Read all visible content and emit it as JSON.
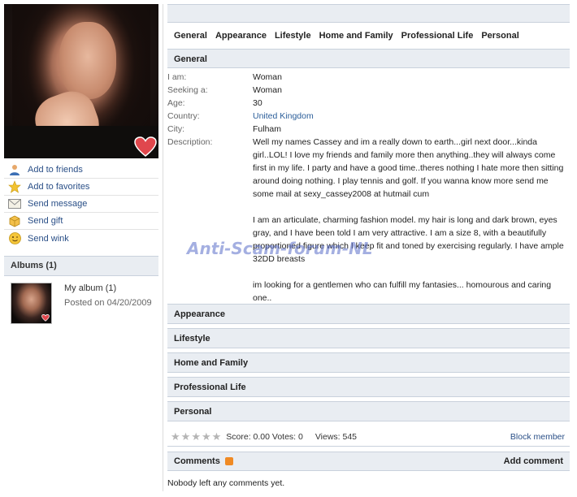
{
  "sidebar": {
    "actions": [
      {
        "label": "Add to friends",
        "icon": "user-icon"
      },
      {
        "label": "Add to favorites",
        "icon": "star-icon"
      },
      {
        "label": "Send message",
        "icon": "envelope-icon"
      },
      {
        "label": "Send gift",
        "icon": "gift-icon"
      },
      {
        "label": "Send wink",
        "icon": "smiley-icon"
      }
    ],
    "albums_title": "Albums (1)",
    "album": {
      "name": "My album (1)",
      "date": "Posted on 04/20/2009"
    }
  },
  "tabs": [
    "General",
    "Appearance",
    "Lifestyle",
    "Home and Family",
    "Professional Life",
    "Personal"
  ],
  "general": {
    "title": "General",
    "fields": [
      {
        "label": "I am:",
        "value": "Woman"
      },
      {
        "label": "Seeking a:",
        "value": "Woman"
      },
      {
        "label": "Age:",
        "value": "30"
      },
      {
        "label": "Country:",
        "value": "United Kingdom"
      },
      {
        "label": "City:",
        "value": "Fulham"
      }
    ],
    "description_label": "Description:",
    "description": [
      "Well my names Cassey and im a really down to earth...girl next door...kinda girl..LOL! I love my friends and family more then anything..they will always come first in my life. I party and have a good time..theres nothing I hate more then sitting around doing nothing. I play tennis and golf. If you wanna know more send me some mail at sexy_cassey2008 at hutmail cum",
      "I am an articulate, charming fashion model. my hair is long and dark brown, eyes gray, and I have been told I am very attractive. I am a size 8, with a beautifully proportioned figure which I keep fit and toned by exercising regularly. I have ample 32DD breasts",
      "im looking for a gentlemen who can fulfill my fantasies... homourous and caring one.."
    ]
  },
  "watermark": "Anti-Scam-forum-NL",
  "sections": [
    "Appearance",
    "Lifestyle",
    "Home and Family",
    "Professional Life",
    "Personal"
  ],
  "rating": {
    "score_text": "Score: 0.00 Votes: 0",
    "views_text": "Views: 545",
    "block_label": "Block member",
    "stars_filled": 0,
    "stars_total": 5
  },
  "comments": {
    "title": "Comments",
    "add_label": "Add comment",
    "empty_text": "Nobody left any comments yet."
  },
  "colors": {
    "link": "#2a4f87",
    "header_bg": "#e9edf2",
    "border": "#c9d1dc",
    "rss": "#f08a24"
  }
}
